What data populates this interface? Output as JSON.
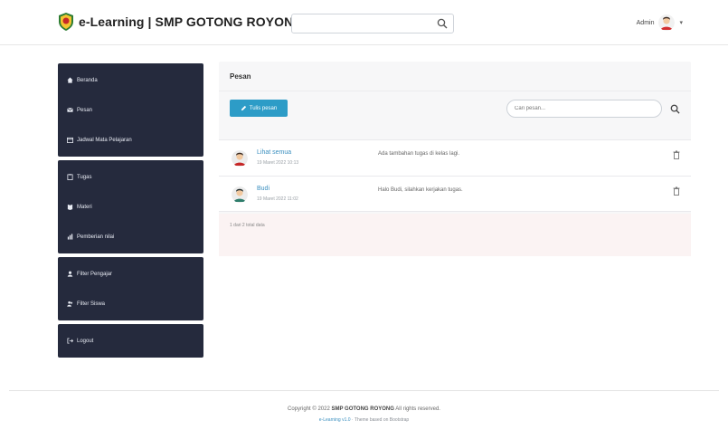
{
  "header": {
    "brand": "e-Learning | SMP GOTONG ROYONG",
    "search_placeholder": "",
    "user_name": "Admin"
  },
  "sidebar": {
    "groups": [
      {
        "items": [
          {
            "label": "Beranda",
            "icon": "home-icon"
          },
          {
            "label": "Pesan",
            "icon": "envelope-icon"
          },
          {
            "label": "Jadwal Mata Pelajaran",
            "icon": "calendar-icon"
          }
        ]
      },
      {
        "items": [
          {
            "label": "Tugas",
            "icon": "clipboard-icon"
          },
          {
            "label": "Materi",
            "icon": "book-icon"
          },
          {
            "label": "Pemberian nilai",
            "icon": "chart-icon"
          }
        ]
      },
      {
        "items": [
          {
            "label": "Filter Pengajar",
            "icon": "user-icon"
          },
          {
            "label": "Filter Siswa",
            "icon": "users-icon"
          }
        ]
      },
      {
        "items": [
          {
            "label": "Logout",
            "icon": "logout-icon"
          }
        ]
      }
    ]
  },
  "main": {
    "title": "Pesan",
    "new_button": "Tulis pesan",
    "search_placeholder": "Cari pesan...",
    "messages": [
      {
        "name": "Lihat semua",
        "date": "19 Maret 2022 10:13",
        "text": "Ada tambahan tugas di kelas lagi."
      },
      {
        "name": "Budi",
        "date": "19 Maret 2022 11:02",
        "text": "Halo Budi, silahkan kerjakan tugas."
      }
    ],
    "count_text": "1 dari 2 total data"
  },
  "footer": {
    "copyright_prefix": "Copyright © 2022",
    "copyright_org": "SMP GOTONG ROYONG",
    "copyright_suffix": "All rights reserved.",
    "line2_version": "e-Learning v1.0",
    "line2_rest": "· Theme based on Bootstrap"
  },
  "colors": {
    "sidebar_bg": "#252a3d",
    "accent": "#2d9cc7",
    "link": "#3a8fbf"
  }
}
